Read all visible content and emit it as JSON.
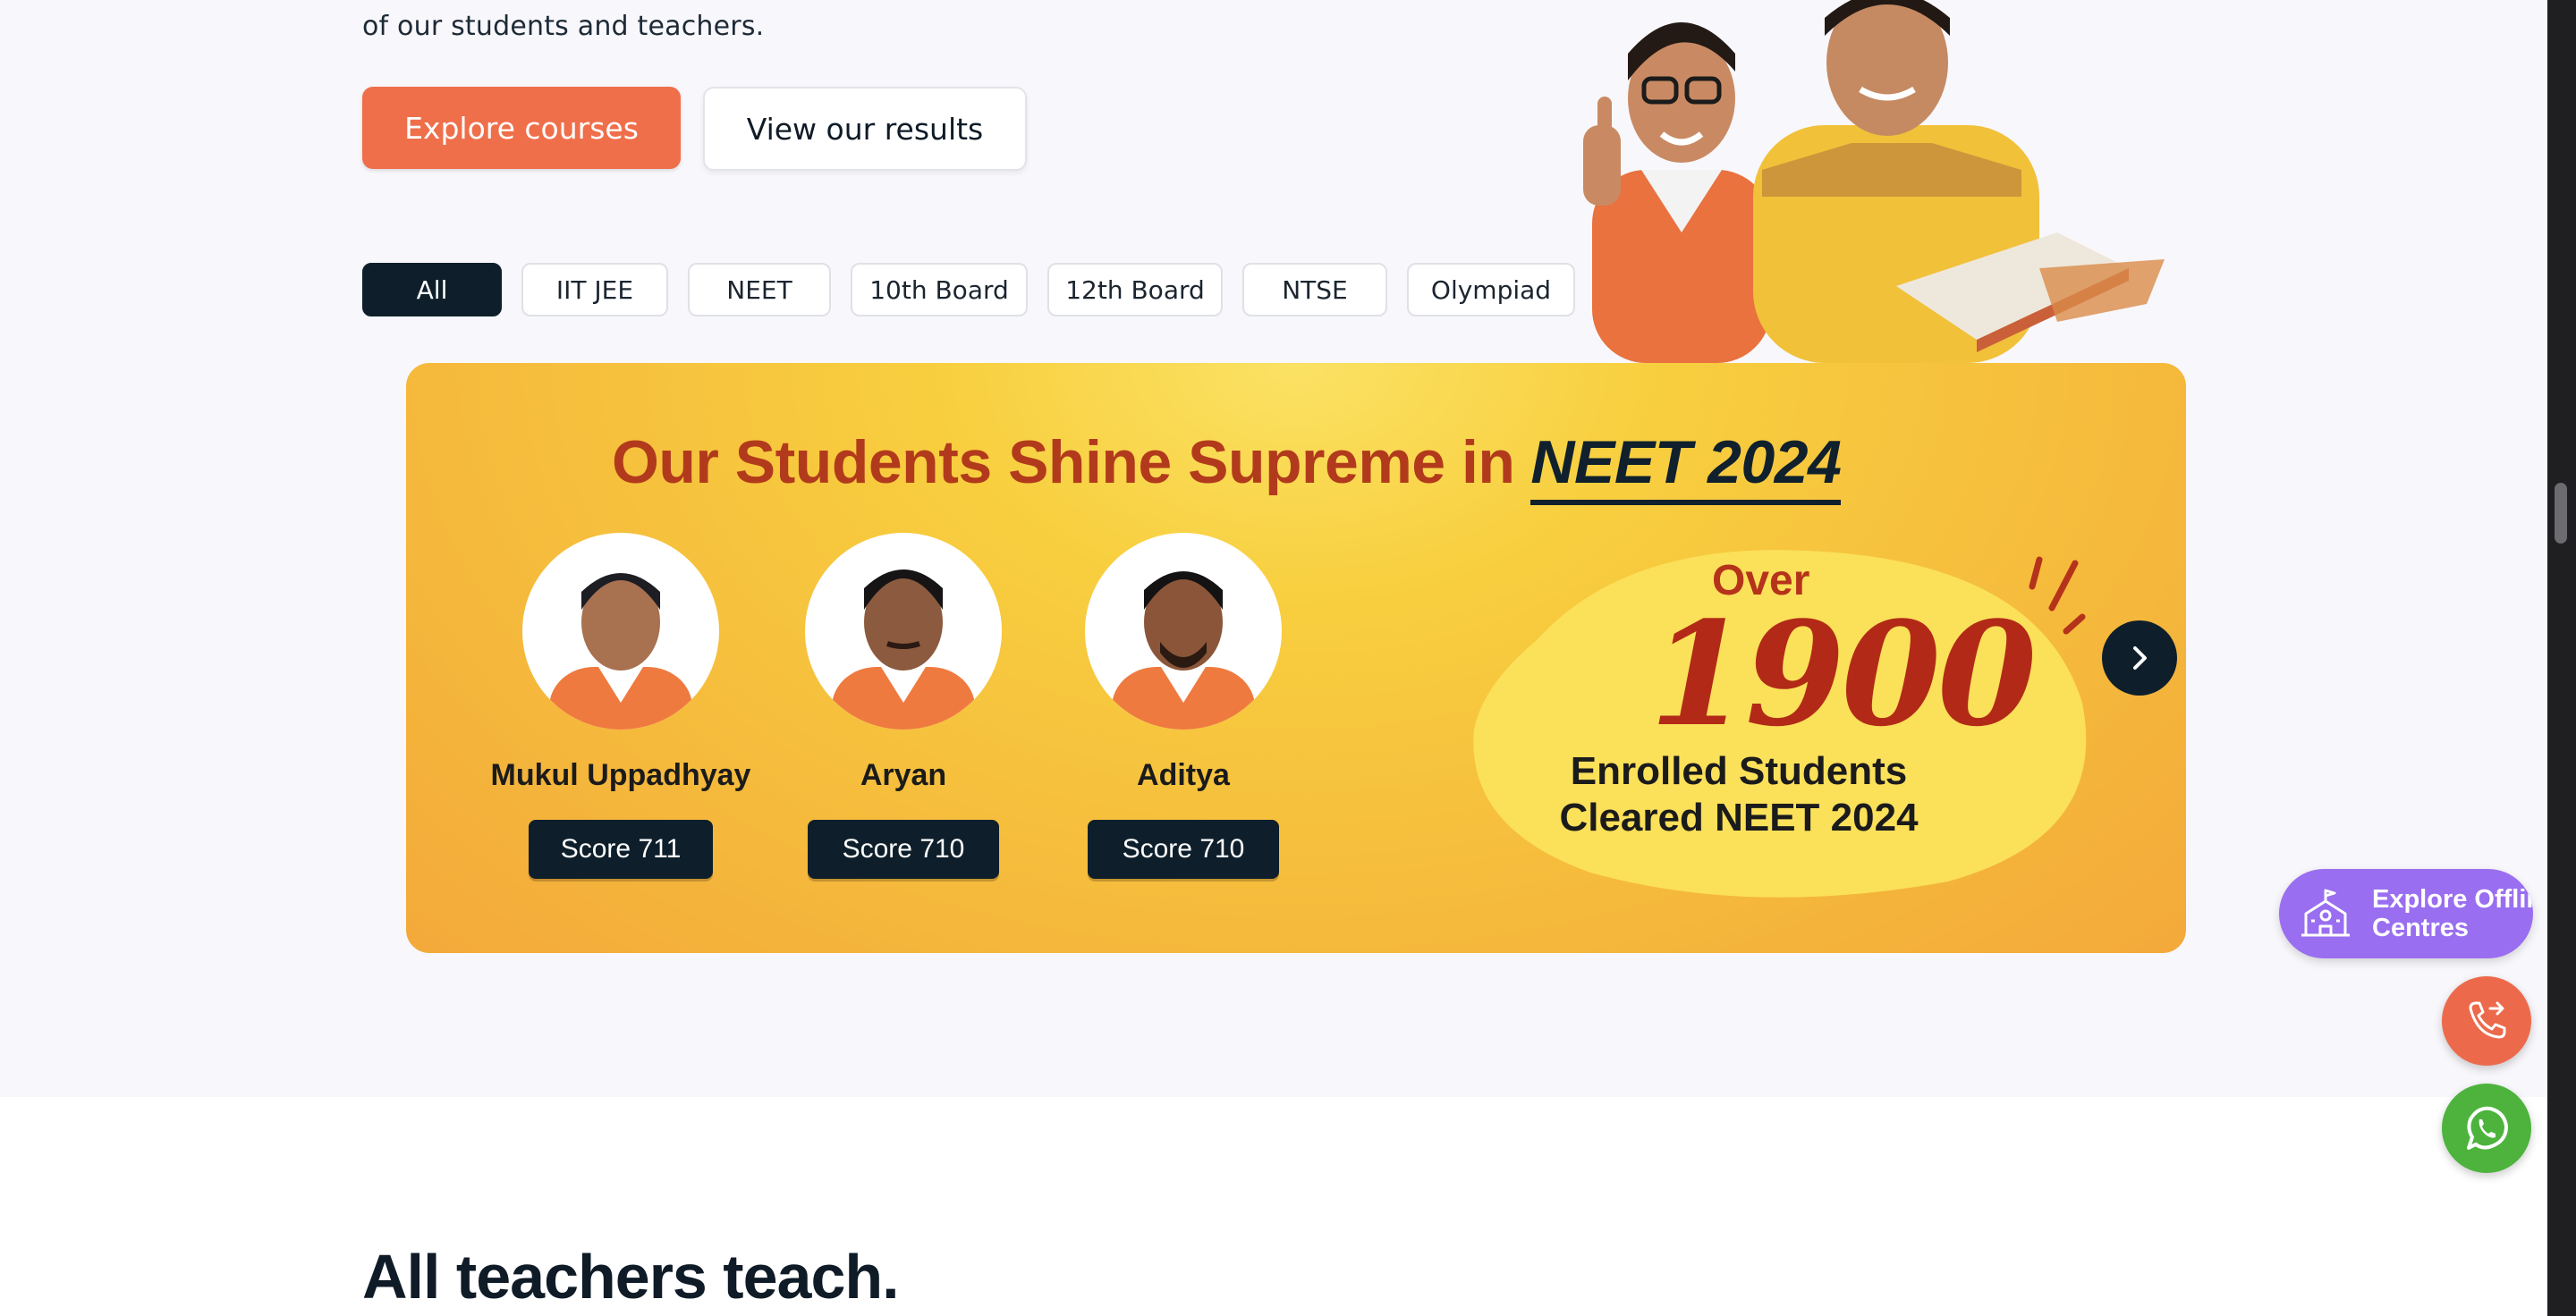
{
  "hero": {
    "intro_text": "of our students and teachers.",
    "explore_button": "Explore courses",
    "results_button": "View our results"
  },
  "filters": [
    "All",
    "IIT JEE",
    "NEET",
    "10th Board",
    "12th Board",
    "NTSE",
    "Olympiad"
  ],
  "banner": {
    "title_prefix": "Our Students Shine Supreme in",
    "title_exam": "NEET 2024",
    "students": [
      {
        "name": "Mukul Uppadhyay",
        "score": "Score 711"
      },
      {
        "name": "Aryan",
        "score": "Score 710"
      },
      {
        "name": "Aditya",
        "score": "Score 710"
      }
    ],
    "stat_over": "Over",
    "stat_number": "1900",
    "stat_line1": "Enrolled Students",
    "stat_line2": "Cleared NEET 2024"
  },
  "section": {
    "heading": "All teachers teach."
  },
  "fab": {
    "centres_line1": "Explore Offlin",
    "centres_line2": "Centres"
  },
  "colors": {
    "accent": "#ef6f4a",
    "dark": "#0e1f2b",
    "purple": "#9a6ef0",
    "whatsapp": "#4db33d"
  },
  "icons": [
    "school-icon",
    "phone-icon",
    "whatsapp-icon",
    "chevron-right-icon"
  ]
}
